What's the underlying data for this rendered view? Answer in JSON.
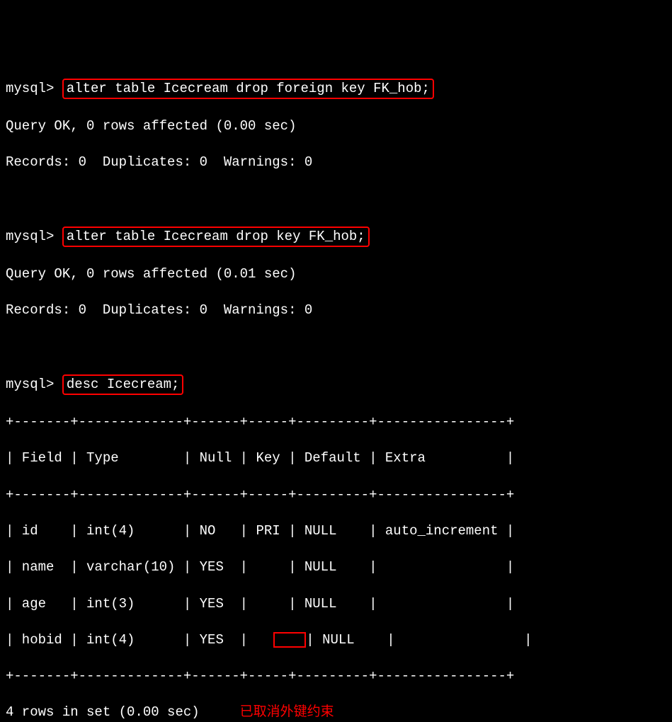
{
  "prompt": "mysql>",
  "commands": {
    "cmd1": "alter table Icecream drop foreign key FK_hob;",
    "cmd2": "alter table Icecream drop key FK_hob;",
    "cmd3": "desc Icecream;"
  },
  "responses": {
    "query_ok1": "Query OK, 0 rows affected (0.00 sec)",
    "records1": "Records: 0  Duplicates: 0  Warnings: 0",
    "query_ok2": "Query OK, 0 rows affected (0.01 sec)",
    "records2": "Records: 0  Duplicates: 0  Warnings: 0",
    "footer": "4 rows in set (0.00 sec)"
  },
  "table": {
    "border_top": "+-------+-------------+------+-----+---------+----------------+",
    "header": "| Field | Type        | Null | Key | Default | Extra          |",
    "row1": "| id    | int(4)      | NO   | PRI | NULL    | auto_increment |",
    "row2": "| name  | varchar(10) | YES  |     | NULL    |                |",
    "row3": "| age   | int(3)      | YES  |     | NULL    |                |",
    "row4_p1": "| hobid | int(4)      | YES  |   ",
    "row4_p2": "| NULL    |                |"
  },
  "annotation": "已取消外键约束",
  "chart_data": {
    "type": "table",
    "title": "desc Icecream",
    "columns": [
      "Field",
      "Type",
      "Null",
      "Key",
      "Default",
      "Extra"
    ],
    "rows": [
      {
        "Field": "id",
        "Type": "int(4)",
        "Null": "NO",
        "Key": "PRI",
        "Default": "NULL",
        "Extra": "auto_increment"
      },
      {
        "Field": "name",
        "Type": "varchar(10)",
        "Null": "YES",
        "Key": "",
        "Default": "NULL",
        "Extra": ""
      },
      {
        "Field": "age",
        "Type": "int(3)",
        "Null": "YES",
        "Key": "",
        "Default": "NULL",
        "Extra": ""
      },
      {
        "Field": "hobid",
        "Type": "int(4)",
        "Null": "YES",
        "Key": "",
        "Default": "NULL",
        "Extra": ""
      }
    ]
  }
}
